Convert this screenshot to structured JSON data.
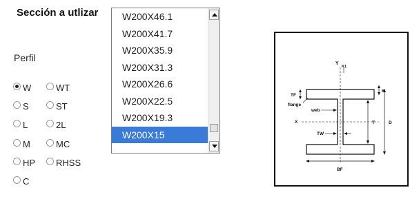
{
  "section_title": "Sección a utlizar",
  "perfil_label": "Perfil",
  "profile_types": [
    {
      "label": "W",
      "checked": true
    },
    {
      "label": "WT",
      "checked": false
    },
    {
      "label": "S",
      "checked": false
    },
    {
      "label": "ST",
      "checked": false
    },
    {
      "label": "L",
      "checked": false
    },
    {
      "label": "2L",
      "checked": false
    },
    {
      "label": "M",
      "checked": false
    },
    {
      "label": "MC",
      "checked": false
    },
    {
      "label": "HP",
      "checked": false
    },
    {
      "label": "RHSS",
      "checked": false
    },
    {
      "label": "C",
      "checked": false
    }
  ],
  "section_list": {
    "items": [
      "W200X46.1",
      "W200X41.7",
      "W200X35.9",
      "W200X31.3",
      "W200X26.6",
      "W200X22.5",
      "W200X19.3",
      "W200X15"
    ],
    "selected": "W200X15",
    "selection_color": "#3b7bd8"
  },
  "diagram": {
    "labels": {
      "y": "Y",
      "k1": "K1",
      "tf": "TF",
      "flange": "flange",
      "x": "X",
      "web": "web",
      "tw": "TW",
      "t": "T",
      "k": "K",
      "d": "D",
      "bf": "BF"
    }
  }
}
